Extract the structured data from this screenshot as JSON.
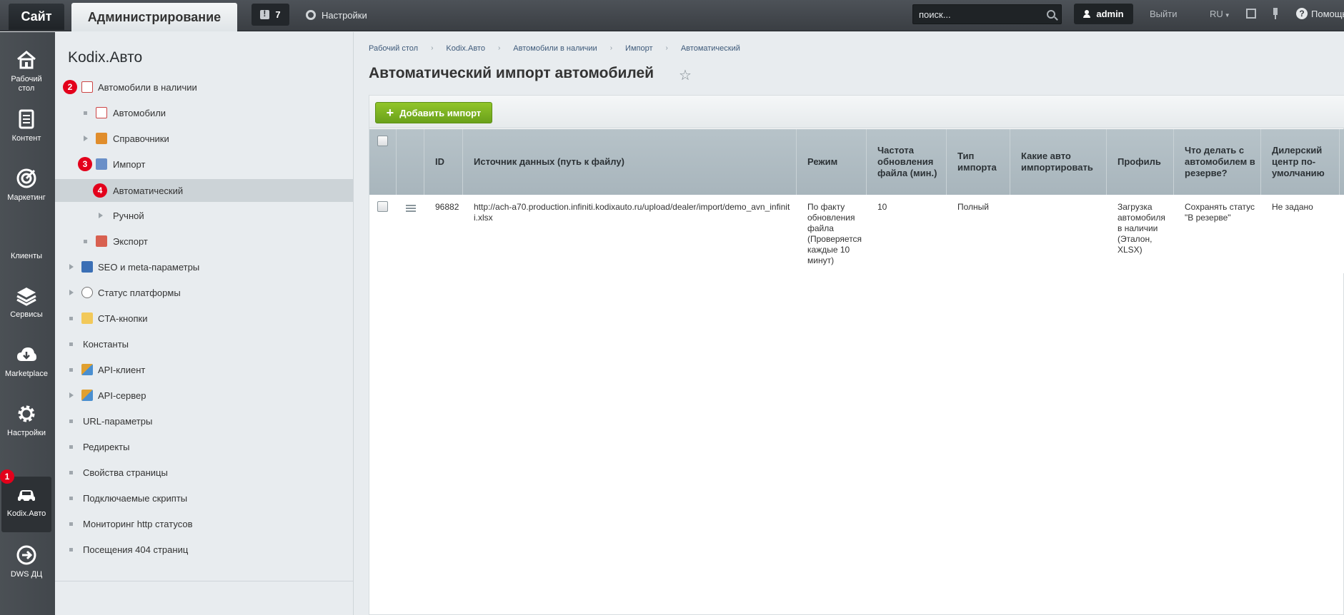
{
  "topbar": {
    "site_tab": "Сайт",
    "admin_tab": "Администрирование",
    "notifications_count": "7",
    "settings_label": "Настройки",
    "search_placeholder": "поиск...",
    "user_name": "admin",
    "logout_label": "Выйти",
    "lang_label": "RU",
    "help_label": "Помощь"
  },
  "leftnav": {
    "items": [
      {
        "label_line1": "Рабочий",
        "label_line2": "стол",
        "icon": "home-icon"
      },
      {
        "label_line1": "Контент",
        "label_line2": "",
        "icon": "document-icon"
      },
      {
        "label_line1": "Маркетинг",
        "label_line2": "",
        "icon": "target-icon"
      },
      {
        "label_line1": "Клиенты",
        "label_line2": "",
        "icon": "clients-icon"
      },
      {
        "label_line1": "Сервисы",
        "label_line2": "",
        "icon": "layers-icon"
      },
      {
        "label_line1": "Marketplace",
        "label_line2": "",
        "icon": "cloud-download-icon"
      },
      {
        "label_line1": "Настройки",
        "label_line2": "",
        "icon": "gear-icon"
      },
      {
        "label_line1": "Kodix.Авто",
        "label_line2": "",
        "icon": "car-icon"
      },
      {
        "label_line1": "DWS ДЦ",
        "label_line2": "",
        "icon": "arrow-circle-icon"
      }
    ],
    "badge_kodix": "1"
  },
  "sidebar": {
    "title": "Kodix.Авто",
    "items": [
      {
        "label": "Автомобили в наличии",
        "badge": "2"
      },
      {
        "label": "Автомобили"
      },
      {
        "label": "Справочники"
      },
      {
        "label": "Импорт",
        "badge": "3"
      },
      {
        "label": "Автоматический",
        "badge": "4"
      },
      {
        "label": "Ручной"
      },
      {
        "label": "Экспорт"
      },
      {
        "label": "SEO и meta-параметры"
      },
      {
        "label": "Статус платформы"
      },
      {
        "label": "CTA-кнопки"
      },
      {
        "label": "Константы"
      },
      {
        "label": "API-клиент"
      },
      {
        "label": "API-сервер"
      },
      {
        "label": "URL-параметры"
      },
      {
        "label": "Редиректы"
      },
      {
        "label": "Свойства страницы"
      },
      {
        "label": "Подключаемые скрипты"
      },
      {
        "label": "Мониторинг http статусов"
      },
      {
        "label": "Посещения 404 страниц"
      }
    ]
  },
  "main": {
    "breadcrumb": [
      "Рабочий стол",
      "Kodix.Авто",
      "Автомобили в наличии",
      "Импорт",
      "Автоматический"
    ],
    "title": "Автоматический импорт автомобилей",
    "add_button": "Добавить импорт",
    "table": {
      "headers": {
        "id": "ID",
        "source": "Источник данных (путь к файлу)",
        "mode": "Режим",
        "frequency": "Частота обновления файла (мин.)",
        "import_type": "Тип импорта",
        "which_cars": "Какие авто импортировать",
        "profile": "Профиль",
        "reserve": "Что делать с автомобилем в резерве?",
        "dealer": "Дилерский центр по-умолчанию"
      },
      "rows": [
        {
          "id": "96882",
          "source": "http://ach-a70.production.infiniti.kodixauto.ru/upload/dealer/import/demo_avn_infiniti.xlsx",
          "mode": "По факту обновления файла (Проверяется каждые 10 минут)",
          "frequency": "10",
          "import_type": "Полный",
          "which_cars": "",
          "profile": "Загрузка автомобиля в наличии (Эталон, XLSX)",
          "reserve": "Сохранять статус \"В резерве\"",
          "dealer": "Не задано"
        }
      ]
    }
  }
}
